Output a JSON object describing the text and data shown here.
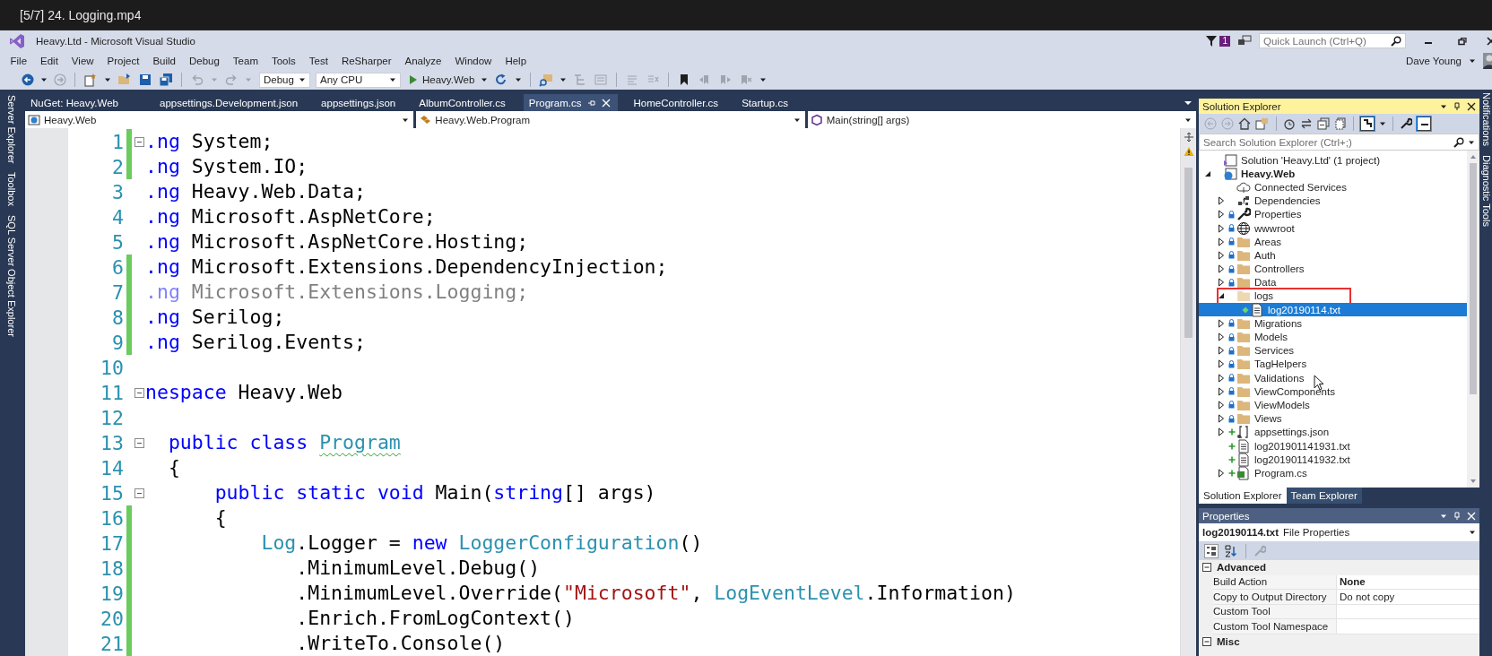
{
  "player": {
    "title": "[5/7] 24. Logging.mp4"
  },
  "window": {
    "title": "Heavy.Ltd - Microsoft Visual Studio",
    "notification_count": "1",
    "quick_launch": {
      "placeholder": "Quick Launch (Ctrl+Q)"
    },
    "user": "Dave Young"
  },
  "menu": [
    "File",
    "Edit",
    "View",
    "Project",
    "Build",
    "Debug",
    "Team",
    "Tools",
    "Test",
    "ReSharper",
    "Analyze",
    "Window",
    "Help"
  ],
  "toolbar": {
    "configuration": "Debug",
    "platform": "Any CPU",
    "start_target": "Heavy.Web"
  },
  "side_tabs_left": [
    "Server Explorer",
    "Toolbox",
    "SQL Server Object Explorer"
  ],
  "side_tabs_right": [
    "Notifications",
    "Diagnostic Tools"
  ],
  "document_tabs": [
    {
      "label": "NuGet: Heavy.Web",
      "selected": false
    },
    {
      "label": "appsettings.Development.json",
      "selected": false
    },
    {
      "label": "appsettings.json",
      "selected": false
    },
    {
      "label": "AlbumController.cs",
      "selected": false
    },
    {
      "label": "Program.cs",
      "selected": true
    },
    {
      "label": "HomeController.cs",
      "selected": false
    },
    {
      "label": "Startup.cs",
      "selected": false
    }
  ],
  "navigation_bar": {
    "project": "Heavy.Web",
    "type": "Heavy.Web.Program",
    "member": "Main(string[] args)"
  },
  "code_lines": [
    {
      "number": "1",
      "changed": true,
      "fold": true,
      "faded": false,
      "tokens": [
        {
          "text": ".ng",
          "kind": "keyword"
        },
        {
          "text": " System;",
          "kind": "plain"
        }
      ]
    },
    {
      "number": "2",
      "changed": true,
      "fold": false,
      "faded": false,
      "tokens": [
        {
          "text": ".ng",
          "kind": "keyword"
        },
        {
          "text": " System.IO;",
          "kind": "plain"
        }
      ]
    },
    {
      "number": "3",
      "changed": false,
      "fold": false,
      "faded": false,
      "tokens": [
        {
          "text": ".ng",
          "kind": "keyword"
        },
        {
          "text": " Heavy.Web.Data;",
          "kind": "plain"
        }
      ]
    },
    {
      "number": "4",
      "changed": false,
      "fold": false,
      "faded": false,
      "tokens": [
        {
          "text": ".ng",
          "kind": "keyword"
        },
        {
          "text": " Microsoft.AspNetCore;",
          "kind": "plain"
        }
      ]
    },
    {
      "number": "5",
      "changed": false,
      "fold": false,
      "faded": false,
      "tokens": [
        {
          "text": ".ng",
          "kind": "keyword"
        },
        {
          "text": " Microsoft.AspNetCore.Hosting;",
          "kind": "plain"
        }
      ]
    },
    {
      "number": "6",
      "changed": true,
      "fold": false,
      "faded": false,
      "tokens": [
        {
          "text": ".ng",
          "kind": "keyword"
        },
        {
          "text": " Microsoft.Extensions.DependencyInjection;",
          "kind": "plain"
        }
      ]
    },
    {
      "number": "7",
      "changed": true,
      "fold": false,
      "faded": true,
      "tokens": [
        {
          "text": ".ng",
          "kind": "keyword"
        },
        {
          "text": " Microsoft.Extensions.Logging;",
          "kind": "plain"
        }
      ]
    },
    {
      "number": "8",
      "changed": true,
      "fold": false,
      "faded": false,
      "tokens": [
        {
          "text": ".ng",
          "kind": "keyword"
        },
        {
          "text": " Serilog;",
          "kind": "plain"
        }
      ]
    },
    {
      "number": "9",
      "changed": true,
      "fold": false,
      "faded": false,
      "tokens": [
        {
          "text": ".ng",
          "kind": "keyword"
        },
        {
          "text": " Serilog.Events;",
          "kind": "plain"
        }
      ]
    },
    {
      "number": "10",
      "changed": false,
      "fold": false
    },
    {
      "number": "11",
      "changed": false,
      "fold": true,
      "faded": false,
      "tokens": [
        {
          "text": "nespace",
          "kind": "keyword"
        },
        {
          "text": " Heavy.Web",
          "kind": "plain"
        }
      ]
    },
    {
      "number": "12",
      "changed": false,
      "fold": false
    },
    {
      "number": "13",
      "changed": false,
      "fold": true,
      "faded": false,
      "tokens": [
        {
          "text": "  public class ",
          "kind": "keyword"
        },
        {
          "text": "Program",
          "kind": "type",
          "squiggle": true
        }
      ]
    },
    {
      "number": "14",
      "changed": false,
      "fold": false,
      "faded": false,
      "tokens": [
        {
          "text": "  {",
          "kind": "plain"
        }
      ]
    },
    {
      "number": "15",
      "changed": false,
      "fold": true,
      "faded": false,
      "tokens": [
        {
          "text": "      public static void",
          "kind": "keyword"
        },
        {
          "text": " Main(",
          "kind": "plain"
        },
        {
          "text": "string",
          "kind": "keyword"
        },
        {
          "text": "[] args)",
          "kind": "plain"
        }
      ]
    },
    {
      "number": "16",
      "changed": true,
      "fold": false,
      "faded": false,
      "tokens": [
        {
          "text": "      {",
          "kind": "plain"
        }
      ]
    },
    {
      "number": "17",
      "changed": true,
      "fold": false,
      "faded": false,
      "tokens": [
        {
          "text": "          Log",
          "kind": "type"
        },
        {
          "text": ".Logger = ",
          "kind": "plain"
        },
        {
          "text": "new ",
          "kind": "keyword"
        },
        {
          "text": "LoggerConfiguration",
          "kind": "type"
        },
        {
          "text": "()",
          "kind": "plain"
        }
      ]
    },
    {
      "number": "18",
      "changed": true,
      "fold": false,
      "faded": false,
      "tokens": [
        {
          "text": "             .MinimumLevel.Debug()",
          "kind": "plain"
        }
      ]
    },
    {
      "number": "19",
      "changed": true,
      "fold": false,
      "faded": false,
      "tokens": [
        {
          "text": "             .MinimumLevel.Override(",
          "kind": "plain"
        },
        {
          "text": "\"Microsoft\"",
          "kind": "string"
        },
        {
          "text": ", ",
          "kind": "plain"
        },
        {
          "text": "LogEventLevel",
          "kind": "type"
        },
        {
          "text": ".Information)",
          "kind": "plain"
        }
      ]
    },
    {
      "number": "20",
      "changed": true,
      "fold": false,
      "faded": false,
      "tokens": [
        {
          "text": "             .Enrich.FromLogContext()",
          "kind": "plain"
        }
      ]
    },
    {
      "number": "21",
      "changed": true,
      "fold": false,
      "faded": false,
      "tokens": [
        {
          "text": "             .WriteTo.Console()",
          "kind": "plain"
        }
      ]
    }
  ],
  "solution_explorer": {
    "title": "Solution Explorer",
    "search_placeholder": "Search Solution Explorer (Ctrl+;)",
    "tree": [
      {
        "label": "Solution 'Heavy.Ltd' (1 project)",
        "kind": "solution",
        "selected": false,
        "children": [
          {
            "label": "Heavy.Web",
            "kind": "project",
            "bold": true,
            "expanded": true,
            "selected": false,
            "children": [
              {
                "label": "Connected Services",
                "kind": "cloud",
                "selected": false
              },
              {
                "label": "Dependencies",
                "kind": "dependencies",
                "expanded": false,
                "selected": false
              },
              {
                "label": "Properties",
                "kind": "wrench",
                "expanded": false,
                "locked": true,
                "selected": false
              },
              {
                "label": "wwwroot",
                "kind": "globe",
                "expanded": false,
                "locked": true,
                "selected": false
              },
              {
                "label": "Areas",
                "kind": "folder",
                "expanded": false,
                "locked": true,
                "selected": false
              },
              {
                "label": "Auth",
                "kind": "folder",
                "expanded": false,
                "locked": true,
                "selected": false
              },
              {
                "label": "Controllers",
                "kind": "folder",
                "expanded": false,
                "locked": true,
                "selected": false
              },
              {
                "label": "Data",
                "kind": "folder",
                "expanded": false,
                "locked": true,
                "selected": false
              },
              {
                "label": "logs",
                "kind": "folder",
                "expanded": true,
                "annotated": true,
                "selected": false,
                "children": [
                  {
                    "label": "log20190114.txt",
                    "kind": "file",
                    "pending": true,
                    "selected": true
                  }
                ]
              },
              {
                "label": "Migrations",
                "kind": "folder",
                "expanded": false,
                "locked": true,
                "selected": false
              },
              {
                "label": "Models",
                "kind": "folder",
                "expanded": false,
                "locked": true,
                "selected": false
              },
              {
                "label": "Services",
                "kind": "folder",
                "expanded": false,
                "locked": true,
                "selected": false
              },
              {
                "label": "TagHelpers",
                "kind": "folder",
                "expanded": false,
                "locked": true,
                "selected": false
              },
              {
                "label": "Validations",
                "kind": "folder",
                "expanded": false,
                "locked": true,
                "selected": false
              },
              {
                "label": "ViewComponents",
                "kind": "folder",
                "expanded": false,
                "locked": true,
                "selected": false
              },
              {
                "label": "ViewModels",
                "kind": "folder",
                "expanded": false,
                "locked": true,
                "selected": false
              },
              {
                "label": "Views",
                "kind": "folder",
                "expanded": false,
                "locked": true,
                "selected": false
              },
              {
                "label": "appsettings.json",
                "kind": "json",
                "expanded": false,
                "added": true,
                "selected": false
              },
              {
                "label": "log201901141931.txt",
                "kind": "file",
                "added": true,
                "selected": false
              },
              {
                "label": "log201901141932.txt",
                "kind": "file",
                "added": true,
                "selected": false
              },
              {
                "label": "Program.cs",
                "kind": "csharp",
                "expanded": false,
                "added": true,
                "selected": false
              }
            ]
          }
        ]
      }
    ],
    "tabs": [
      {
        "label": "Solution Explorer",
        "selected": true
      },
      {
        "label": "Team Explorer",
        "selected": false
      }
    ]
  },
  "properties": {
    "title": "Properties",
    "object_name": "log20190114.txt",
    "object_type": "File Properties",
    "categories": [
      {
        "name": "Advanced",
        "expanded": true,
        "rows": [
          {
            "name": "Build Action",
            "value": "None",
            "bold": true
          },
          {
            "name": "Copy to Output Directory",
            "value": "Do not copy",
            "bold": false
          },
          {
            "name": "Custom Tool",
            "bold": false
          },
          {
            "name": "Custom Tool Namespace",
            "bold": false
          }
        ]
      },
      {
        "name": "Misc",
        "expanded": true
      }
    ]
  }
}
